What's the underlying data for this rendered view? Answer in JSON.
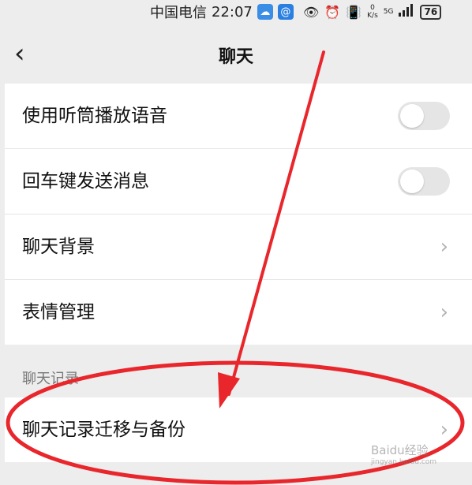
{
  "status_bar": {
    "carrier": "中国电信",
    "time": "22:07",
    "net_speed_value": "0",
    "net_speed_unit": "K/s",
    "network": "5G",
    "battery": "76"
  },
  "header": {
    "title": "聊天"
  },
  "settings_group_1": [
    {
      "label": "使用听筒播放语音",
      "control": "toggle",
      "on": false
    },
    {
      "label": "回车键发送消息",
      "control": "toggle",
      "on": false
    },
    {
      "label": "聊天背景",
      "control": "chevron"
    },
    {
      "label": "表情管理",
      "control": "chevron"
    }
  ],
  "section_header": "聊天记录",
  "settings_group_2": [
    {
      "label": "聊天记录迁移与备份",
      "control": "chevron"
    }
  ],
  "watermark": {
    "main": "Baidu经验",
    "sub": "jingyan.baidu.com"
  },
  "colors": {
    "background": "#ededed",
    "annotation_red": "#e8262b",
    "toggle_off": "#e5e5e5"
  }
}
